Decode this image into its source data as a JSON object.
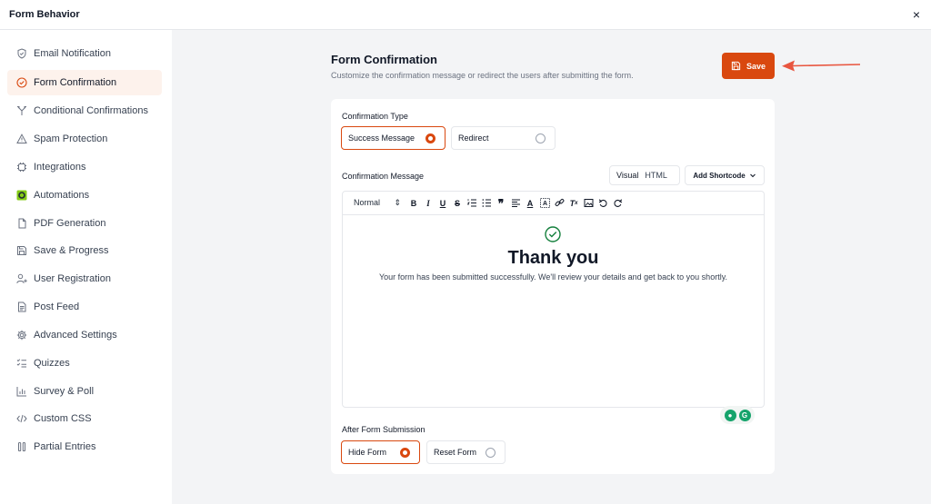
{
  "window": {
    "title": "Form Behavior",
    "close_label": "×"
  },
  "sidebar": {
    "items": [
      {
        "label": "Email Notification",
        "icon": "shield-icon"
      },
      {
        "label": "Form Confirmation",
        "icon": "check-circle-icon",
        "active": true
      },
      {
        "label": "Conditional Confirmations",
        "icon": "branch-icon"
      },
      {
        "label": "Spam Protection",
        "icon": "warning-icon"
      },
      {
        "label": "Integrations",
        "icon": "plug-icon"
      },
      {
        "label": "Automations",
        "icon": "automation-icon"
      },
      {
        "label": "PDF Generation",
        "icon": "file-icon"
      },
      {
        "label": "Save & Progress",
        "icon": "save-icon"
      },
      {
        "label": "User Registration",
        "icon": "user-add-icon"
      },
      {
        "label": "Post Feed",
        "icon": "document-icon"
      },
      {
        "label": "Advanced Settings",
        "icon": "gear-icon"
      },
      {
        "label": "Quizzes",
        "icon": "checklist-icon"
      },
      {
        "label": "Survey & Poll",
        "icon": "bar-chart-icon"
      },
      {
        "label": "Custom CSS",
        "icon": "code-icon"
      },
      {
        "label": "Partial Entries",
        "icon": "columns-icon"
      }
    ]
  },
  "header": {
    "title": "Form Confirmation",
    "subtitle": "Customize the confirmation message or redirect the users after submitting the form.",
    "save_label": "Save"
  },
  "confirmation_type": {
    "label": "Confirmation Type",
    "options": [
      {
        "label": "Success Message",
        "selected": true
      },
      {
        "label": "Redirect",
        "selected": false
      }
    ]
  },
  "message": {
    "label": "Confirmation Message",
    "tab_visual": "Visual",
    "tab_html": "HTML",
    "shortcut_label": "Add Shortcode",
    "format_select": "Normal",
    "heading": "Thank you",
    "body": "Your form has been submitted successfully. We'll review your details and get back to you shortly."
  },
  "after_submission": {
    "label": "After Form Submission",
    "options": [
      {
        "label": "Hide Form",
        "selected": true
      },
      {
        "label": "Reset Form",
        "selected": false
      }
    ]
  },
  "colors": {
    "accent": "#d9480f",
    "active_bg": "#fdf2ec",
    "arrow": "#e8553f",
    "success": "#15803d"
  }
}
